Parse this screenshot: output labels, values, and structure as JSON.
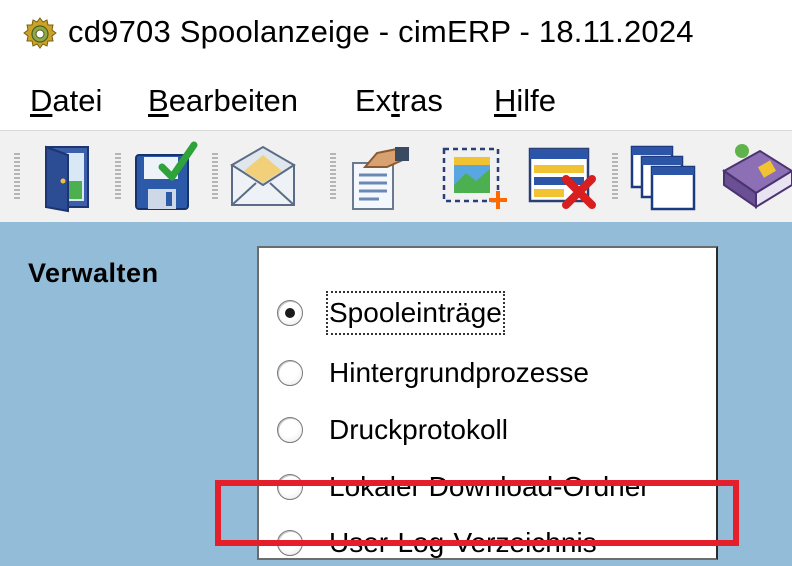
{
  "window": {
    "title": "cd9703 Spoolanzeige - cimERP - 18.11.2024",
    "icon": "gear-icon"
  },
  "menu": {
    "items": [
      {
        "mnemonic": "D",
        "rest": "atei"
      },
      {
        "mnemonic": "B",
        "rest": "earbeiten"
      },
      {
        "pre": "Ex",
        "mnemonic": "t",
        "rest": "ras"
      },
      {
        "mnemonic": "H",
        "rest": "ilfe"
      }
    ]
  },
  "toolbar": {
    "buttons": [
      "exit-door-icon",
      "save-check-icon",
      "envelope-icon",
      "hand-document-icon",
      "new-image-icon",
      "delete-list-icon",
      "windows-icon",
      "book-icon"
    ]
  },
  "main": {
    "section_label": "Verwalten",
    "options": [
      {
        "label": "Spooleinträge",
        "checked": true
      },
      {
        "label": "Hintergrundprozesse",
        "checked": false
      },
      {
        "label": "Druckprotokoll",
        "checked": false
      },
      {
        "label": "Lokaler Download-Ordner",
        "checked": false
      },
      {
        "label": "User-Log-Verzeichnis",
        "checked": false
      }
    ]
  },
  "colors": {
    "main_background": "#92bcd7",
    "highlight": "#e41e2b"
  }
}
